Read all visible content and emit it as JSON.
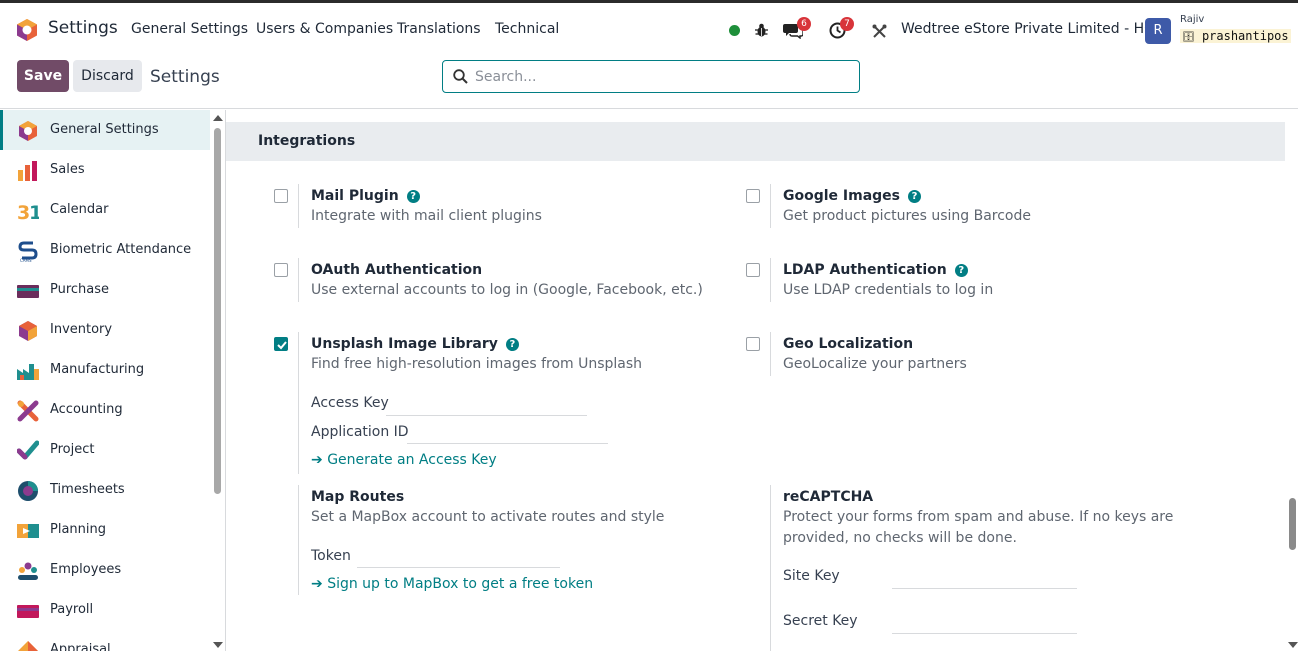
{
  "topbar": {
    "app_title": "Settings",
    "menu": [
      "General Settings",
      "Users & Companies",
      "Translations",
      "Technical"
    ],
    "chat_count": "6",
    "activity_count": "7",
    "company": "Wedtree eStore Private Limited - HO",
    "avatar_letter": "R",
    "user": "Rajiv",
    "database": "prashantipos",
    "colors": {
      "status_online": "#1e8f3a",
      "badge": "#d8343a",
      "avatar": "#3e5aa8"
    }
  },
  "controls": {
    "save_label": "Save",
    "discard_label": "Discard",
    "breadcrumb": "Settings",
    "search_placeholder": "Search...",
    "colors": {
      "save": "#714b67",
      "accent": "#017e84"
    }
  },
  "sidebar": {
    "items": [
      {
        "label": "General Settings",
        "icon": "odoo-settings-icon",
        "active": true
      },
      {
        "label": "Sales",
        "icon": "sales-icon"
      },
      {
        "label": "Calendar",
        "icon": "calendar-icon"
      },
      {
        "label": "Biometric Attendance",
        "icon": "biometric-icon"
      },
      {
        "label": "Purchase",
        "icon": "purchase-icon"
      },
      {
        "label": "Inventory",
        "icon": "inventory-icon"
      },
      {
        "label": "Manufacturing",
        "icon": "manufacturing-icon"
      },
      {
        "label": "Accounting",
        "icon": "accounting-icon"
      },
      {
        "label": "Project",
        "icon": "project-icon"
      },
      {
        "label": "Timesheets",
        "icon": "timesheets-icon"
      },
      {
        "label": "Planning",
        "icon": "planning-icon"
      },
      {
        "label": "Employees",
        "icon": "employees-icon"
      },
      {
        "label": "Payroll",
        "icon": "payroll-icon"
      },
      {
        "label": "Appraisal",
        "icon": "appraisal-icon"
      }
    ]
  },
  "main": {
    "section_title": "Integrations",
    "settings": {
      "mail_plugin": {
        "title": "Mail Plugin",
        "desc": "Integrate with mail client plugins",
        "checked": false
      },
      "google_images": {
        "title": "Google Images",
        "desc": "Get product pictures using Barcode",
        "checked": false
      },
      "oauth": {
        "title": "OAuth Authentication",
        "desc": "Use external accounts to log in (Google, Facebook, etc.)",
        "checked": false
      },
      "ldap": {
        "title": "LDAP Authentication",
        "desc": "Use LDAP credentials to log in",
        "checked": false
      },
      "unsplash": {
        "title": "Unsplash Image Library",
        "desc": "Find free high-resolution images from Unsplash",
        "checked": true,
        "access_key_label": "Access Key",
        "app_id_label": "Application ID",
        "link": "Generate an Access Key"
      },
      "geo": {
        "title": "Geo Localization",
        "desc": "GeoLocalize your partners",
        "checked": false
      },
      "map_routes": {
        "title": "Map Routes",
        "desc": "Set a MapBox account to activate routes and style",
        "token_label": "Token",
        "link": "Sign up to MapBox to get a free token"
      },
      "recaptcha": {
        "title": "reCAPTCHA",
        "desc_1": "Protect your forms from spam and abuse. If no keys are",
        "desc_2": "provided, no checks will be done.",
        "site_key_label": "Site Key",
        "secret_key_label": "Secret Key"
      }
    }
  }
}
